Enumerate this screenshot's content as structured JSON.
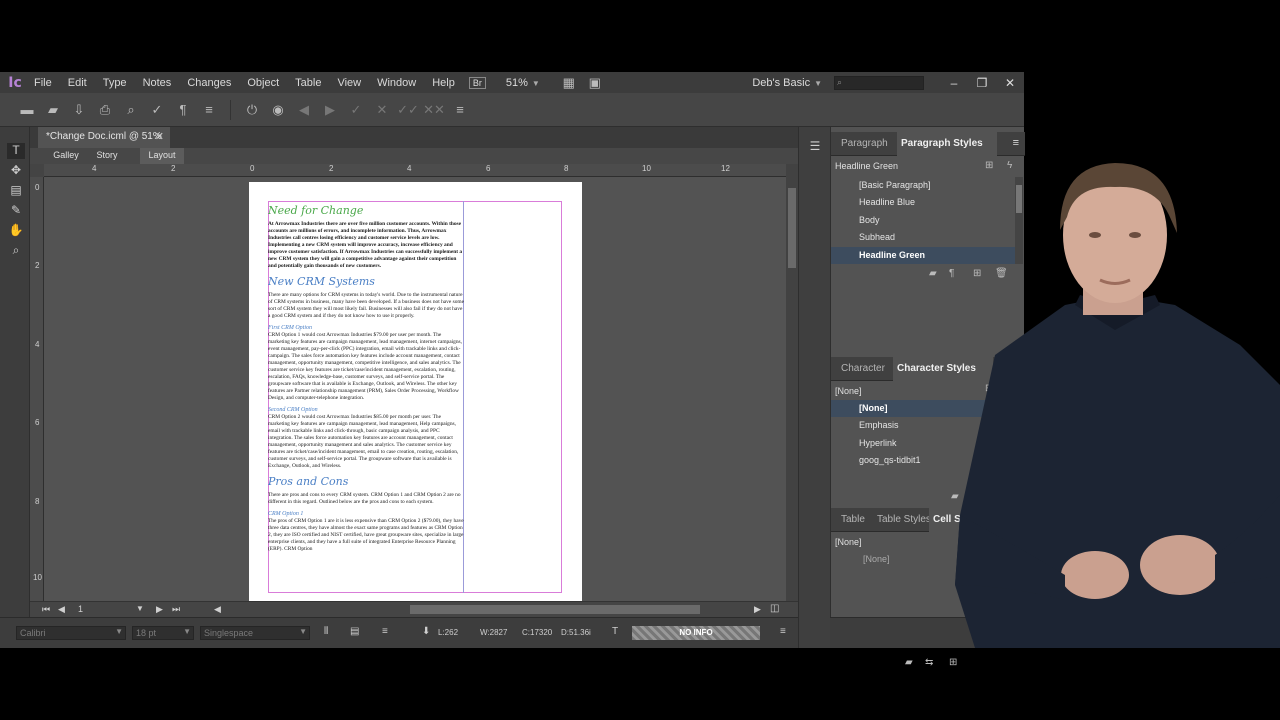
{
  "menubar": {
    "app_icon": "Ic",
    "items": [
      "File",
      "Edit",
      "Type",
      "Notes",
      "Changes",
      "Object",
      "Table",
      "View",
      "Window",
      "Help"
    ],
    "bridge_label": "Br",
    "zoom": "51%",
    "workspace": "Deb's Basic",
    "search_placeholder": ""
  },
  "document": {
    "tab_title": "*Change Doc.icml @ 51%",
    "view_tabs": [
      "Galley",
      "Story",
      "Layout"
    ],
    "active_view": "Layout"
  },
  "ruler": {
    "h_labels": [
      "4",
      "2",
      "0",
      "2",
      "4",
      "6",
      "8",
      "10",
      "12"
    ],
    "v_labels": [
      "0",
      "2",
      "4",
      "6",
      "8",
      "10"
    ]
  },
  "story": {
    "headline1": "Need for Change",
    "para1": "At Arrowmax Industries there are over five million customer accounts. Within those accounts are millions of errors, and incomplete information. Thus, Arrowmax Industries call centres losing efficiency and customer service levels are low. Implementing a new CRM system will improve accuracy, increase efficiency and improve customer satisfaction. If Arrowmax Industries can successfully implement a new CRM system they will gain a competitive advantage against their competition and potentially gain thousands of new customers.",
    "headline2": "New CRM Systems",
    "para2": "There are many options for CRM systems in today's world. Due to the instrumental nature of CRM systems in business, many have been developed. If a business does not have some sort of CRM system they will most likely fail. Businesses will also fail if they do not have a good CRM system and if they do not know how to use it properly.",
    "sub1": "First CRM Option",
    "para3": "CRM Option 1 would cost Arrowmax Industries $79.00 per user per month. The marketing key features are campaign management, lead management, internet campaigns, event management, pay-per-click (PPC) integration, email with trackable links and click-campaign. The sales force automation key features include account management, contact management, opportunity management, competitive intelligence, and sales analytics. The customer service key features are ticket/case/incident management, escalation, routing, escalation, FAQs, knowledge-base, customer surveys, and self-service portal. The groupware software that is available is Exchange, Outlook, and Wireless. The other key features are Partner relationship management (PRM), Sales Order Processing, Workflow Design, and computer-telephone integration.",
    "sub2": "Second CRM Option",
    "para4": "CRM Option 2 would cost Arrowmax Industries $85.00 per month per user. The marketing key features are campaign management, lead management, Help campaigns, email with trackable links and click-through, basic campaign analysis, and PPC integration. The sales force automation key features are account management, contact management, opportunity management and sales analytics. The customer service key features are ticket/case/incident management, email to case creation, routing, escalation, customer surveys, and self-service portal. The groupware software that is available is Exchange, Outlook, and Wireless.",
    "headline3": "Pros and Cons",
    "para5": "There are pros and cons to every CRM system. CRM Option 1 and CRM Option 2 are no different in this regard. Outlined below are the pros and cons to each system.",
    "sub3": "CRM Option 1",
    "para6": "The pros of CRM Option 1 are it is less expensive than CRM Option 2 ($79.00), they have three data centres, they have almost the exact same programs and features as CRM Option 2, they are ISO certified and NIST certified, have great groupware sites, specialize in large enterprise clients, and they have a full suite of integrated Enterprise Resource Planning (ERP). CRM Option"
  },
  "nav": {
    "page_number": "1"
  },
  "bottombar": {
    "font": "Calibri",
    "size": "18 pt",
    "spacing": "Singlespace",
    "lines": "L:262",
    "words": "W:2827",
    "chars": "C:17320",
    "depth": "D:51.36i",
    "no_info": "NO INFO"
  },
  "paragraph_panel": {
    "tabs": [
      "Paragraph",
      "Paragraph Styles"
    ],
    "current": "Headline Green",
    "styles": [
      "[Basic Paragraph]",
      "Headline Blue",
      "Body",
      "Subhead",
      "Headline Green"
    ],
    "selected": "Headline Green"
  },
  "character_panel": {
    "tabs": [
      "Character",
      "Character Styles"
    ],
    "current": "[None]",
    "styles": [
      "[None]",
      "Emphasis",
      "Hyperlink",
      "goog_qs-tidbit1"
    ],
    "selected": "[None]"
  },
  "table_panel": {
    "tabs": [
      "Table",
      "Table Styles",
      "Cell Styles"
    ],
    "current": "[None]",
    "styles": [
      "[None]"
    ]
  },
  "colors": {
    "headline_green": "#4aa84a",
    "headline_blue": "#4a7fc5",
    "margin_guide": "#d97cd9",
    "selection": "#3d4c5e",
    "app_accent": "#b783d6"
  }
}
